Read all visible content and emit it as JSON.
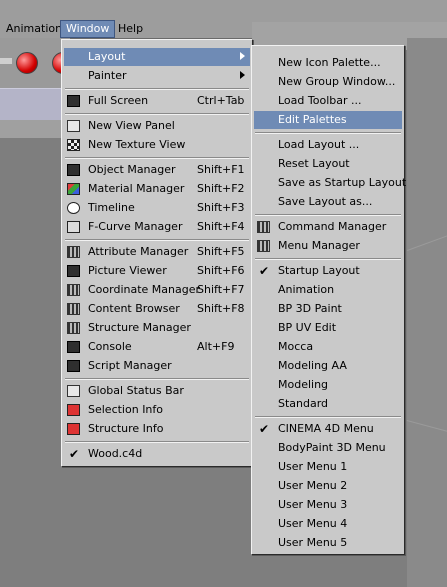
{
  "menubar": {
    "items": [
      "Animation",
      "Window",
      "Help"
    ],
    "active": "Window"
  },
  "window_menu": {
    "items": [
      {
        "label": "Layout",
        "submenu": true,
        "highlighted": true
      },
      {
        "label": "Painter",
        "submenu": true
      },
      {
        "label": "Full Screen",
        "shortcut": "Ctrl+Tab",
        "icon": "fullscreen-icon"
      },
      {
        "label": "New View Panel",
        "icon": "view-panel-icon"
      },
      {
        "label": "New Texture View",
        "icon": "texture-view-icon"
      },
      {
        "label": "Object Manager",
        "shortcut": "Shift+F1",
        "icon": "object-manager-icon"
      },
      {
        "label": "Material Manager",
        "shortcut": "Shift+F2",
        "icon": "material-manager-icon"
      },
      {
        "label": "Timeline",
        "shortcut": "Shift+F3",
        "icon": "timeline-icon"
      },
      {
        "label": "F-Curve Manager",
        "shortcut": "Shift+F4",
        "icon": "fcurve-icon"
      },
      {
        "label": "Attribute Manager",
        "shortcut": "Shift+F5",
        "icon": "attribute-manager-icon"
      },
      {
        "label": "Picture Viewer",
        "shortcut": "Shift+F6",
        "icon": "picture-viewer-icon"
      },
      {
        "label": "Coordinate Manager",
        "shortcut": "Shift+F7",
        "icon": "coordinate-manager-icon"
      },
      {
        "label": "Content Browser",
        "shortcut": "Shift+F8",
        "icon": "content-browser-icon"
      },
      {
        "label": "Structure Manager",
        "icon": "structure-manager-icon"
      },
      {
        "label": "Console",
        "shortcut": "Alt+F9",
        "icon": "console-icon"
      },
      {
        "label": "Script Manager",
        "icon": "script-manager-icon"
      },
      {
        "label": "Global Status Bar",
        "icon": "status-bar-icon"
      },
      {
        "label": "Selection Info",
        "icon": "selection-info-icon"
      },
      {
        "label": "Structure Info",
        "icon": "structure-info-icon"
      },
      {
        "label": "Wood.c4d",
        "checked": true
      }
    ]
  },
  "layout_menu": {
    "items": [
      {
        "label": "New Icon Palette..."
      },
      {
        "label": "New Group Window..."
      },
      {
        "label": "Load Toolbar ..."
      },
      {
        "label": "Edit Palettes",
        "highlighted": true
      },
      {
        "label": "Load Layout ..."
      },
      {
        "label": "Reset Layout"
      },
      {
        "label": "Save as Startup Layout"
      },
      {
        "label": "Save Layout as..."
      },
      {
        "label": "Command Manager",
        "icon": "command-manager-icon"
      },
      {
        "label": "Menu Manager",
        "icon": "menu-manager-icon"
      },
      {
        "label": "Startup Layout",
        "checked": true
      },
      {
        "label": "Animation"
      },
      {
        "label": "BP 3D Paint"
      },
      {
        "label": "BP UV Edit"
      },
      {
        "label": "Mocca"
      },
      {
        "label": "Modeling AA"
      },
      {
        "label": "Modeling"
      },
      {
        "label": "Standard"
      },
      {
        "label": "CINEMA 4D Menu",
        "checked": true
      },
      {
        "label": "BodyPaint 3D Menu"
      },
      {
        "label": "User Menu 1"
      },
      {
        "label": "User Menu 2"
      },
      {
        "label": "User Menu 3"
      },
      {
        "label": "User Menu 4"
      },
      {
        "label": "User Menu 5"
      }
    ]
  },
  "colors": {
    "highlight": "#6f8bb5",
    "menu_bg": "#c9c9c9",
    "workspace": "#7e7e7e"
  },
  "check_glyph": "✔"
}
